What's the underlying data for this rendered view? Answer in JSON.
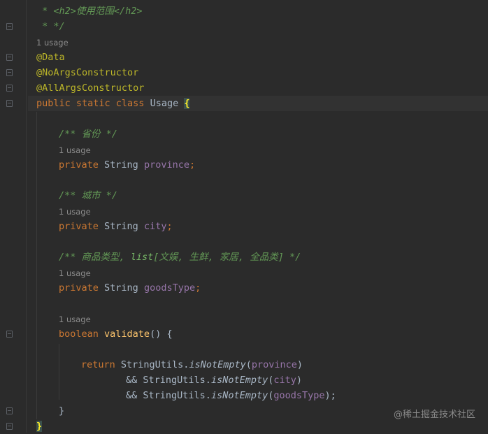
{
  "editor": {
    "usage_label": "1 usage",
    "lines": {
      "javadoc_h2": " * <h2>使用范围</h2>",
      "javadoc_end": " * */",
      "ann_data": "@Data",
      "ann_noargs": "@NoArgsConstructor",
      "ann_allargs": "@AllArgsConstructor",
      "class_kw": "public static class ",
      "class_name": "Usage ",
      "class_open": "{",
      "doc_province": "/** 省份 */",
      "doc_city": "/** 城市 */",
      "doc_goods_prefix": "/** 商品类型, ",
      "doc_goods_list": "list",
      "doc_goods_suffix": "[文娱, 生鲜, 家居, 全品类] */",
      "kw_private": "private ",
      "type_string": "String ",
      "field_province": "province",
      "field_city": "city",
      "field_goods": "goodsType",
      "semicolon": ";",
      "kw_boolean": "boolean ",
      "method_validate": "validate",
      "method_sig_tail": "() {",
      "kw_return": "return ",
      "stringutils_dot": "StringUtils.",
      "is_not_empty": "isNotEmpty",
      "paren_open": "(",
      "paren_close": ")",
      "paren_close_semi": ");",
      "and_op": "&& ",
      "method_close": "}",
      "class_close": "}"
    }
  },
  "watermark": "@稀土掘金技术社区",
  "colors": {
    "background": "#2b2b2b",
    "keyword": "#cc7832",
    "annotation": "#bbb529",
    "javadoc": "#629755",
    "field": "#9876aa",
    "method": "#ffc66d",
    "text": "#a9b7c6"
  }
}
